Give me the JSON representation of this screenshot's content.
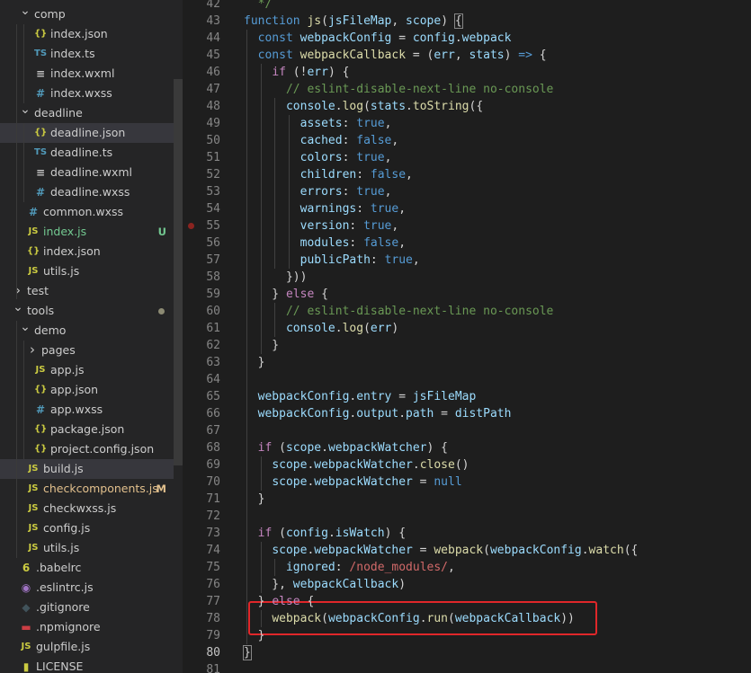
{
  "explorer": {
    "rows": [
      {
        "label": "comp",
        "kind": "folder",
        "open": true,
        "depth": 1
      },
      {
        "label": "index.json",
        "kind": "json",
        "depth": 2
      },
      {
        "label": "index.ts",
        "kind": "ts",
        "depth": 2
      },
      {
        "label": "index.wxml",
        "kind": "wxml",
        "depth": 2
      },
      {
        "label": "index.wxss",
        "kind": "wxss",
        "depth": 2
      },
      {
        "label": "deadline",
        "kind": "folder",
        "open": true,
        "depth": 1
      },
      {
        "label": "deadline.json",
        "kind": "json",
        "depth": 2,
        "selected": true
      },
      {
        "label": "deadline.ts",
        "kind": "ts",
        "depth": 2
      },
      {
        "label": "deadline.wxml",
        "kind": "wxml",
        "depth": 2
      },
      {
        "label": "deadline.wxss",
        "kind": "wxss",
        "depth": 2
      },
      {
        "label": "common.wxss",
        "kind": "wxss",
        "depth": 1
      },
      {
        "label": "index.js",
        "kind": "js",
        "depth": 1,
        "badge": "U",
        "badgeColor": "#73c991",
        "labelColor": "#73c991"
      },
      {
        "label": "index.json",
        "kind": "json",
        "depth": 1
      },
      {
        "label": "utils.js",
        "kind": "js",
        "depth": 1
      },
      {
        "label": "test",
        "kind": "folder",
        "open": false,
        "depth": 0
      },
      {
        "label": "tools",
        "kind": "folder",
        "open": true,
        "depth": 0,
        "dot": true
      },
      {
        "label": "demo",
        "kind": "folder",
        "open": true,
        "depth": 1
      },
      {
        "label": "pages",
        "kind": "folder",
        "open": false,
        "depth": 2
      },
      {
        "label": "app.js",
        "kind": "js",
        "depth": 2
      },
      {
        "label": "app.json",
        "kind": "json",
        "depth": 2
      },
      {
        "label": "app.wxss",
        "kind": "wxss",
        "depth": 2
      },
      {
        "label": "package.json",
        "kind": "json",
        "depth": 2
      },
      {
        "label": "project.config.json",
        "kind": "json",
        "depth": 2
      },
      {
        "label": "build.js",
        "kind": "js",
        "depth": 1,
        "selected": true
      },
      {
        "label": "checkcomponents.js",
        "kind": "js",
        "depth": 1,
        "badge": "M",
        "badgeColor": "#e2c08d",
        "labelColor": "#e2c08d"
      },
      {
        "label": "checkwxss.js",
        "kind": "js",
        "depth": 1
      },
      {
        "label": "config.js",
        "kind": "js",
        "depth": 1
      },
      {
        "label": "utils.js",
        "kind": "js",
        "depth": 1
      },
      {
        "label": ".babelrc",
        "kind": "babel",
        "depth": 0
      },
      {
        "label": ".eslintrc.js",
        "kind": "eslint",
        "depth": 0
      },
      {
        "label": ".gitignore",
        "kind": "git",
        "depth": 0
      },
      {
        "label": ".npmignore",
        "kind": "npm",
        "depth": 0
      },
      {
        "label": "gulpfile.js",
        "kind": "js",
        "depth": 0
      },
      {
        "label": "LICENSE",
        "kind": "license",
        "depth": 0
      }
    ],
    "icons": {
      "json": {
        "glyph": "{}",
        "color": "#cbcb41"
      },
      "ts": {
        "glyph": "TS",
        "color": "#519aba"
      },
      "wxml": {
        "glyph": "≡",
        "color": "#c5c5c5"
      },
      "wxss": {
        "glyph": "#",
        "color": "#519aba"
      },
      "js": {
        "glyph": "JS",
        "color": "#cbcb41"
      },
      "babel": {
        "glyph": "6",
        "color": "#cbcb41"
      },
      "eslint": {
        "glyph": "◉",
        "color": "#a074c4"
      },
      "git": {
        "glyph": "◆",
        "color": "#41535b"
      },
      "npm": {
        "glyph": "▬",
        "color": "#cc3e44"
      },
      "license": {
        "glyph": "▮",
        "color": "#cbcb41"
      }
    }
  },
  "editor": {
    "current_line": 80,
    "breakpoint_line": 55,
    "lines": [
      {
        "n": 42,
        "t": [
          [
            "cm",
            "  */"
          ]
        ]
      },
      {
        "n": 43,
        "t": [
          [
            "kw",
            "function "
          ],
          [
            "fn",
            "js"
          ],
          [
            "pn",
            "("
          ],
          [
            "vr",
            "jsFileMap"
          ],
          [
            "pn",
            ", "
          ],
          [
            "vr",
            "scope"
          ],
          [
            "pn",
            ") "
          ],
          [
            "bm",
            "{"
          ]
        ]
      },
      {
        "n": 44,
        "t": [
          [
            "pn",
            "  "
          ],
          [
            "kw",
            "const "
          ],
          [
            "vr",
            "webpackConfig"
          ],
          [
            "pn",
            " = "
          ],
          [
            "vr",
            "config"
          ],
          [
            "pn",
            "."
          ],
          [
            "vr",
            "webpack"
          ]
        ]
      },
      {
        "n": 45,
        "t": [
          [
            "pn",
            "  "
          ],
          [
            "kw",
            "const "
          ],
          [
            "fn",
            "webpackCallback"
          ],
          [
            "pn",
            " = ("
          ],
          [
            "vr",
            "err"
          ],
          [
            "pn",
            ", "
          ],
          [
            "vr",
            "stats"
          ],
          [
            "pn",
            ") "
          ],
          [
            "kw",
            "=>"
          ],
          [
            "pn",
            " {"
          ]
        ]
      },
      {
        "n": 46,
        "t": [
          [
            "pn",
            "    "
          ],
          [
            "cf",
            "if"
          ],
          [
            "pn",
            " (!"
          ],
          [
            "vr",
            "err"
          ],
          [
            "pn",
            ") {"
          ]
        ]
      },
      {
        "n": 47,
        "t": [
          [
            "pn",
            "      "
          ],
          [
            "cm",
            "// eslint-disable-next-line no-console"
          ]
        ]
      },
      {
        "n": 48,
        "t": [
          [
            "pn",
            "      "
          ],
          [
            "vr",
            "console"
          ],
          [
            "pn",
            "."
          ],
          [
            "fn",
            "log"
          ],
          [
            "pn",
            "("
          ],
          [
            "vr",
            "stats"
          ],
          [
            "pn",
            "."
          ],
          [
            "fn",
            "toString"
          ],
          [
            "pn",
            "({"
          ]
        ]
      },
      {
        "n": 49,
        "t": [
          [
            "pn",
            "        "
          ],
          [
            "vr",
            "assets"
          ],
          [
            "pn",
            ": "
          ],
          [
            "kw",
            "true"
          ],
          [
            "pn",
            ","
          ]
        ]
      },
      {
        "n": 50,
        "t": [
          [
            "pn",
            "        "
          ],
          [
            "vr",
            "cached"
          ],
          [
            "pn",
            ": "
          ],
          [
            "kw",
            "false"
          ],
          [
            "pn",
            ","
          ]
        ]
      },
      {
        "n": 51,
        "t": [
          [
            "pn",
            "        "
          ],
          [
            "vr",
            "colors"
          ],
          [
            "pn",
            ": "
          ],
          [
            "kw",
            "true"
          ],
          [
            "pn",
            ","
          ]
        ]
      },
      {
        "n": 52,
        "t": [
          [
            "pn",
            "        "
          ],
          [
            "vr",
            "children"
          ],
          [
            "pn",
            ": "
          ],
          [
            "kw",
            "false"
          ],
          [
            "pn",
            ","
          ]
        ]
      },
      {
        "n": 53,
        "t": [
          [
            "pn",
            "        "
          ],
          [
            "vr",
            "errors"
          ],
          [
            "pn",
            ": "
          ],
          [
            "kw",
            "true"
          ],
          [
            "pn",
            ","
          ]
        ]
      },
      {
        "n": 54,
        "t": [
          [
            "pn",
            "        "
          ],
          [
            "vr",
            "warnings"
          ],
          [
            "pn",
            ": "
          ],
          [
            "kw",
            "true"
          ],
          [
            "pn",
            ","
          ]
        ]
      },
      {
        "n": 55,
        "t": [
          [
            "pn",
            "        "
          ],
          [
            "vr",
            "version"
          ],
          [
            "pn",
            ": "
          ],
          [
            "kw",
            "true"
          ],
          [
            "pn",
            ","
          ]
        ]
      },
      {
        "n": 56,
        "t": [
          [
            "pn",
            "        "
          ],
          [
            "vr",
            "modules"
          ],
          [
            "pn",
            ": "
          ],
          [
            "kw",
            "false"
          ],
          [
            "pn",
            ","
          ]
        ]
      },
      {
        "n": 57,
        "t": [
          [
            "pn",
            "        "
          ],
          [
            "vr",
            "publicPath"
          ],
          [
            "pn",
            ": "
          ],
          [
            "kw",
            "true"
          ],
          [
            "pn",
            ","
          ]
        ]
      },
      {
        "n": 58,
        "t": [
          [
            "pn",
            "      }))"
          ]
        ]
      },
      {
        "n": 59,
        "t": [
          [
            "pn",
            "    } "
          ],
          [
            "cf",
            "else"
          ],
          [
            "pn",
            " {"
          ]
        ]
      },
      {
        "n": 60,
        "t": [
          [
            "pn",
            "      "
          ],
          [
            "cm",
            "// eslint-disable-next-line no-console"
          ]
        ]
      },
      {
        "n": 61,
        "t": [
          [
            "pn",
            "      "
          ],
          [
            "vr",
            "console"
          ],
          [
            "pn",
            "."
          ],
          [
            "fn",
            "log"
          ],
          [
            "pn",
            "("
          ],
          [
            "vr",
            "err"
          ],
          [
            "pn",
            ")"
          ]
        ]
      },
      {
        "n": 62,
        "t": [
          [
            "pn",
            "    }"
          ]
        ]
      },
      {
        "n": 63,
        "t": [
          [
            "pn",
            "  }"
          ]
        ]
      },
      {
        "n": 64,
        "t": []
      },
      {
        "n": 65,
        "t": [
          [
            "pn",
            "  "
          ],
          [
            "vr",
            "webpackConfig"
          ],
          [
            "pn",
            "."
          ],
          [
            "vr",
            "entry"
          ],
          [
            "pn",
            " = "
          ],
          [
            "vr",
            "jsFileMap"
          ]
        ]
      },
      {
        "n": 66,
        "t": [
          [
            "pn",
            "  "
          ],
          [
            "vr",
            "webpackConfig"
          ],
          [
            "pn",
            "."
          ],
          [
            "vr",
            "output"
          ],
          [
            "pn",
            "."
          ],
          [
            "vr",
            "path"
          ],
          [
            "pn",
            " = "
          ],
          [
            "vr",
            "distPath"
          ]
        ]
      },
      {
        "n": 67,
        "t": []
      },
      {
        "n": 68,
        "t": [
          [
            "pn",
            "  "
          ],
          [
            "cf",
            "if"
          ],
          [
            "pn",
            " ("
          ],
          [
            "vr",
            "scope"
          ],
          [
            "pn",
            "."
          ],
          [
            "vr",
            "webpackWatcher"
          ],
          [
            "pn",
            ") {"
          ]
        ]
      },
      {
        "n": 69,
        "t": [
          [
            "pn",
            "    "
          ],
          [
            "vr",
            "scope"
          ],
          [
            "pn",
            "."
          ],
          [
            "vr",
            "webpackWatcher"
          ],
          [
            "pn",
            "."
          ],
          [
            "fn",
            "close"
          ],
          [
            "pn",
            "()"
          ]
        ]
      },
      {
        "n": 70,
        "t": [
          [
            "pn",
            "    "
          ],
          [
            "vr",
            "scope"
          ],
          [
            "pn",
            "."
          ],
          [
            "vr",
            "webpackWatcher"
          ],
          [
            "pn",
            " = "
          ],
          [
            "kw",
            "null"
          ]
        ]
      },
      {
        "n": 71,
        "t": [
          [
            "pn",
            "  }"
          ]
        ]
      },
      {
        "n": 72,
        "t": []
      },
      {
        "n": 73,
        "t": [
          [
            "pn",
            "  "
          ],
          [
            "cf",
            "if"
          ],
          [
            "pn",
            " ("
          ],
          [
            "vr",
            "config"
          ],
          [
            "pn",
            "."
          ],
          [
            "vr",
            "isWatch"
          ],
          [
            "pn",
            ") {"
          ]
        ]
      },
      {
        "n": 74,
        "t": [
          [
            "pn",
            "    "
          ],
          [
            "vr",
            "scope"
          ],
          [
            "pn",
            "."
          ],
          [
            "vr",
            "webpackWatcher"
          ],
          [
            "pn",
            " = "
          ],
          [
            "fn",
            "webpack"
          ],
          [
            "pn",
            "("
          ],
          [
            "vr",
            "webpackConfig"
          ],
          [
            "pn",
            "."
          ],
          [
            "fn",
            "watch"
          ],
          [
            "pn",
            "({"
          ]
        ]
      },
      {
        "n": 75,
        "t": [
          [
            "pn",
            "      "
          ],
          [
            "vr",
            "ignored"
          ],
          [
            "pn",
            ": "
          ],
          [
            "rx",
            "/node_modules/"
          ],
          [
            "pn",
            ","
          ]
        ]
      },
      {
        "n": 76,
        "t": [
          [
            "pn",
            "    }, "
          ],
          [
            "vr",
            "webpackCallback"
          ],
          [
            "pn",
            ")"
          ]
        ]
      },
      {
        "n": 77,
        "t": [
          [
            "pn",
            "  } "
          ],
          [
            "cf",
            "else"
          ],
          [
            "pn",
            " {"
          ]
        ]
      },
      {
        "n": 78,
        "t": [
          [
            "pn",
            "    "
          ],
          [
            "fn",
            "webpack"
          ],
          [
            "pn",
            "("
          ],
          [
            "vr",
            "webpackConfig"
          ],
          [
            "pn",
            "."
          ],
          [
            "fn",
            "run"
          ],
          [
            "pn",
            "("
          ],
          [
            "vr",
            "webpackCallback"
          ],
          [
            "pn",
            "))"
          ]
        ]
      },
      {
        "n": 79,
        "t": [
          [
            "pn",
            "  }"
          ]
        ]
      },
      {
        "n": 80,
        "t": [
          [
            "bm",
            "}"
          ]
        ]
      },
      {
        "n": 81,
        "t": []
      }
    ]
  }
}
